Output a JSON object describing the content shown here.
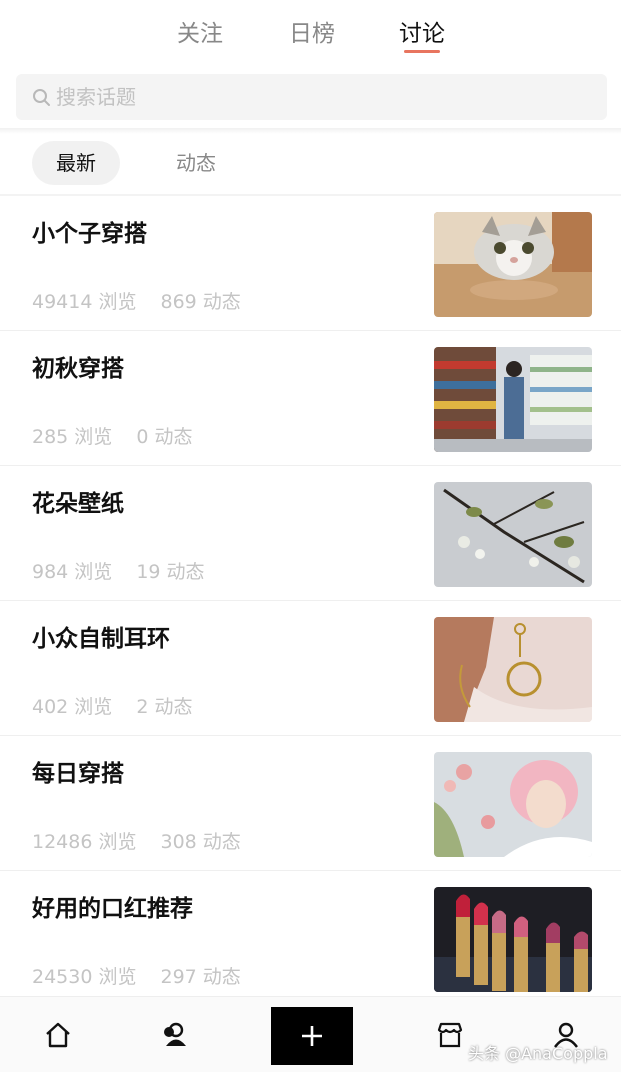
{
  "top_tabs": [
    {
      "label": "关注",
      "active": false
    },
    {
      "label": "日榜",
      "active": false
    },
    {
      "label": "讨论",
      "active": true
    }
  ],
  "search": {
    "placeholder": "搜索话题",
    "icon": "search-icon"
  },
  "sub_tabs": [
    {
      "label": "最新",
      "active": true
    },
    {
      "label": "动态",
      "active": false
    }
  ],
  "topics": [
    {
      "title": "小个子穿搭",
      "views": "49414 浏览",
      "posts": "869 动态",
      "thumbnail": "cat-photo"
    },
    {
      "title": "初秋穿搭",
      "views": "285 浏览",
      "posts": "0 动态",
      "thumbnail": "supermarket-outfit-photo"
    },
    {
      "title": "花朵壁纸",
      "views": "984 浏览",
      "posts": "19 动态",
      "thumbnail": "blossom-branch-photo"
    },
    {
      "title": "小众自制耳环",
      "views": "402 浏览",
      "posts": "2 动态",
      "thumbnail": "gold-earring-photo"
    },
    {
      "title": "每日穿搭",
      "views": "12486 浏览",
      "posts": "308 动态",
      "thumbnail": "pink-hair-portrait-photo"
    },
    {
      "title": "好用的口红推荐",
      "views": "24530 浏览",
      "posts": "297 动态",
      "thumbnail": "lipsticks-photo"
    }
  ],
  "bottom_nav": [
    {
      "icon": "home-icon"
    },
    {
      "icon": "friends-icon"
    },
    {
      "icon": "plus-icon"
    },
    {
      "icon": "store-icon"
    },
    {
      "icon": "profile-icon"
    }
  ],
  "watermark": "头条 @AnaCoppla",
  "colors": {
    "accent": "#e8755f",
    "muted_text": "#c4c4c4",
    "tab_inactive": "#888888",
    "post_button": "#000000"
  }
}
